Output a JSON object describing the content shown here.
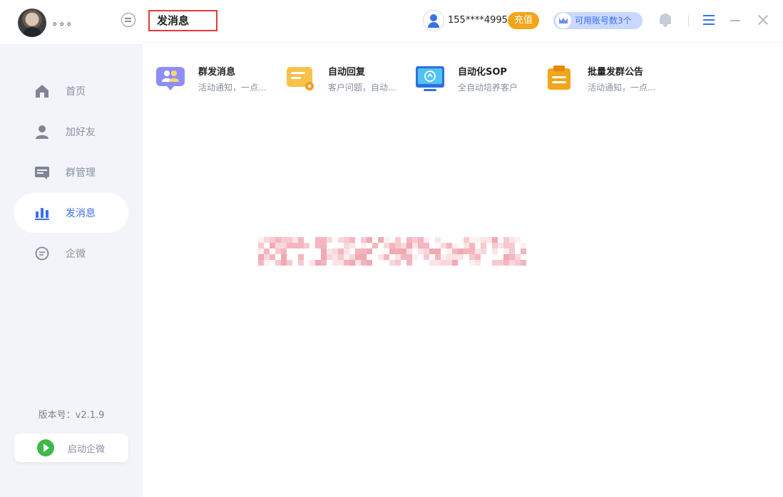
{
  "profile": {
    "nickname": "。。。"
  },
  "sidebar": {
    "items": [
      {
        "label": "首页",
        "icon": "home-icon"
      },
      {
        "label": "加好友",
        "icon": "user-icon"
      },
      {
        "label": "群管理",
        "icon": "group-manage-icon"
      },
      {
        "label": "发消息",
        "icon": "message-chart-icon",
        "active": true
      },
      {
        "label": "企微",
        "icon": "chat-bubble-icon"
      }
    ],
    "version": "版本号：v2.1.9",
    "start_label": "启动企微"
  },
  "header": {
    "title": "发消息",
    "phone": "155****4995",
    "recharge_label": "充值",
    "accounts_label": "可用账号数3个"
  },
  "features": [
    {
      "title": "群发消息",
      "desc": "活动通知，一点...",
      "icon": "group-send-icon"
    },
    {
      "title": "自动回复",
      "desc": "客户问题，自动...",
      "icon": "auto-reply-icon"
    },
    {
      "title": "自动化SOP",
      "desc": "全自动培养客户",
      "icon": "sop-monitor-icon"
    },
    {
      "title": "批量发群公告",
      "desc": "活动通知，一点...",
      "icon": "announcement-icon"
    }
  ],
  "colors": {
    "accent": "#3a6ff2",
    "recharge": "#f3a51b",
    "sidebar_bg": "#f2f4fa",
    "highlight_border": "#e23a3a"
  }
}
